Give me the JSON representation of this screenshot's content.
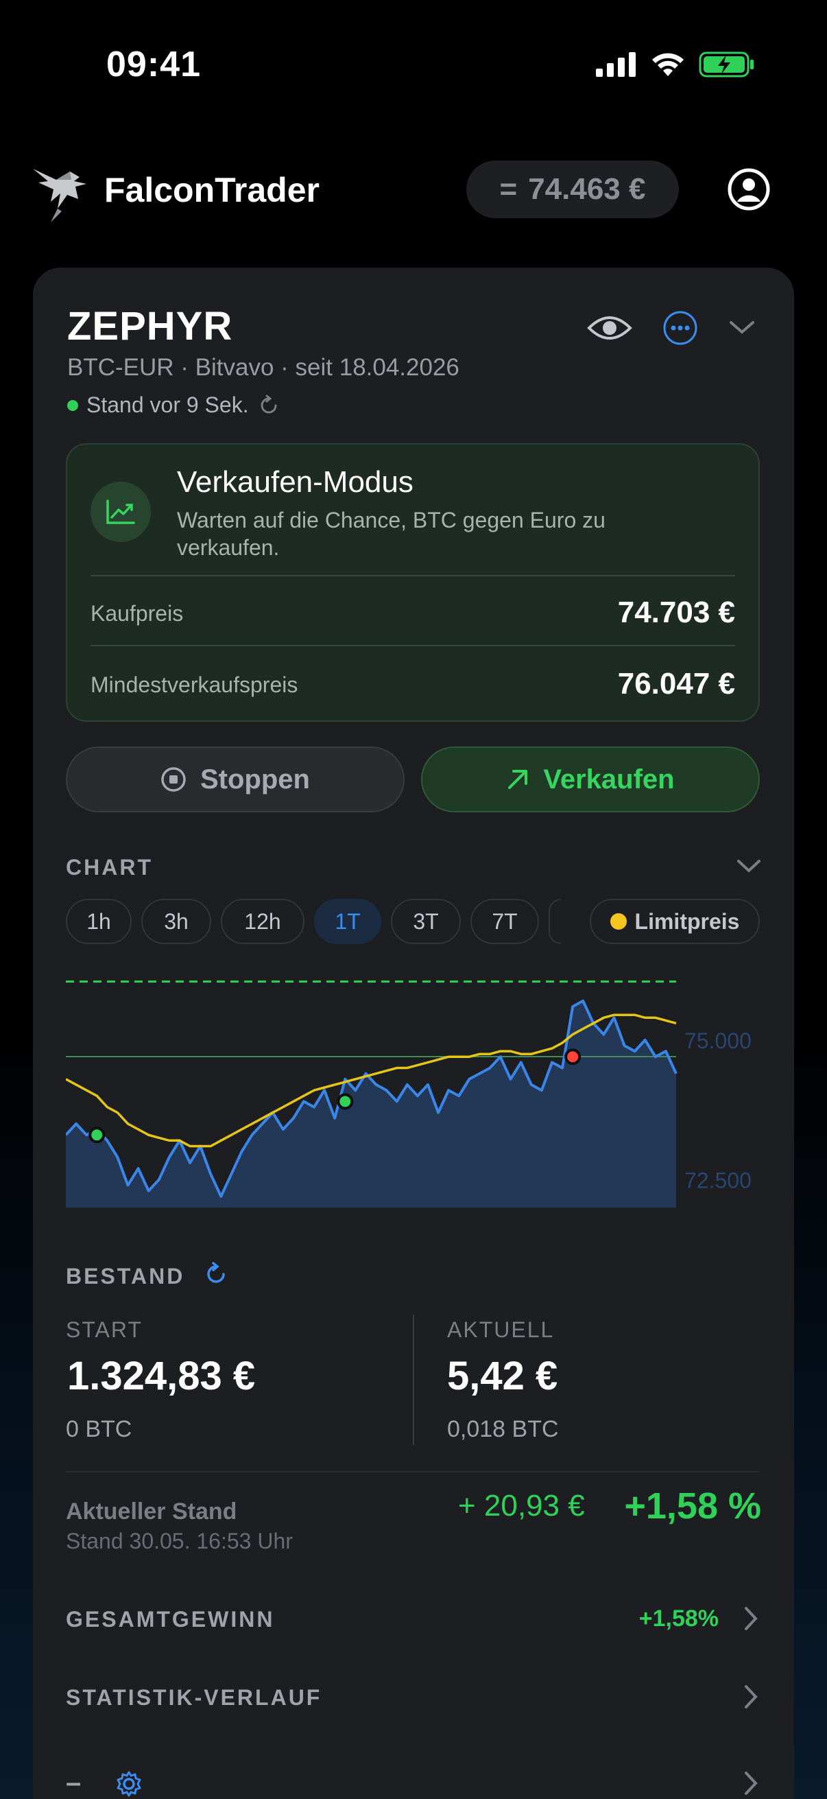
{
  "status_bar": {
    "time": "09:41"
  },
  "header": {
    "app_name": "FalconTrader",
    "balance_prefix": "=",
    "balance": "74.463 €"
  },
  "strategy": {
    "name": "ZEPHYR",
    "meta": "BTC-EUR · Bitvavo · seit 18.04.2026",
    "status": "Stand vor 9 Sek."
  },
  "mode": {
    "title": "Verkaufen-Modus",
    "description": "Warten auf die Chance, BTC gegen Euro zu verkaufen.",
    "rows": [
      {
        "label": "Kaufpreis",
        "value": "74.703 €"
      },
      {
        "label": "Mindestverkaufspreis",
        "value": "76.047 €"
      }
    ]
  },
  "actions": {
    "stop_label": "Stoppen",
    "sell_label": "Verkaufen"
  },
  "chart_section": {
    "label": "CHART",
    "ranges": [
      "1h",
      "3h",
      "12h",
      "1T",
      "3T",
      "7T"
    ],
    "active_range": "1T",
    "limit_label": "Limitpreis"
  },
  "chart_data": {
    "type": "area",
    "y_tick_labels": [
      "75.000",
      "72.500"
    ],
    "ylim": [
      72000,
      76300
    ],
    "limit_price": 76047,
    "buy_price": 74703,
    "series": [
      {
        "values": [
          73300,
          73500,
          73300,
          73400,
          73200,
          72900,
          72400,
          72700,
          72300,
          72500,
          72900,
          73200,
          72800,
          73100,
          72600,
          72200,
          72600,
          73000,
          73300,
          73500,
          73700,
          73400,
          73600,
          73900,
          73800,
          74100,
          73600,
          74300,
          74100,
          74400,
          74200,
          74100,
          73900,
          74200,
          74000,
          74200,
          73700,
          74100,
          74000,
          74300,
          74400,
          74500,
          74700,
          74300,
          74600,
          74200,
          74100,
          74600,
          74500,
          75600,
          75700,
          75300,
          75100,
          75400,
          74900,
          74800,
          75000,
          74700,
          74800,
          74400
        ]
      },
      {
        "values": [
          74300,
          74200,
          74100,
          74000,
          73800,
          73700,
          73500,
          73400,
          73300,
          73250,
          73200,
          73200,
          73100,
          73100,
          73100,
          73200,
          73300,
          73400,
          73500,
          73600,
          73700,
          73800,
          73900,
          74000,
          74100,
          74150,
          74200,
          74250,
          74300,
          74350,
          74400,
          74450,
          74500,
          74500,
          74550,
          74600,
          74650,
          74700,
          74700,
          74700,
          74750,
          74750,
          74800,
          74800,
          74750,
          74750,
          74800,
          74850,
          74950,
          75100,
          75200,
          75300,
          75400,
          75450,
          75450,
          75450,
          75400,
          75400,
          75350,
          75300
        ]
      }
    ],
    "markers": [
      {
        "index": 3,
        "value": 73300,
        "kind": "buy"
      },
      {
        "index": 27,
        "value": 73900,
        "kind": "buy"
      },
      {
        "index": 49,
        "value": 74700,
        "kind": "sell"
      }
    ],
    "colors": {
      "price": "#3a86e8",
      "average": "#e6c51b",
      "limit": "#2fd158",
      "buy": "#2fd158",
      "sell": "#ff453a"
    }
  },
  "holdings": {
    "label": "BESTAND",
    "start": {
      "label": "START",
      "value": "1.324,83 €",
      "sub": "0 BTC"
    },
    "current": {
      "label": "AKTUELL",
      "value": "5,42 €",
      "sub": "0,018 BTC"
    }
  },
  "current_state": {
    "label": "Aktueller Stand",
    "sub": "Stand 30.05. 16:53 Uhr",
    "abs": "+ 20,93 €",
    "pct": "+1,58 %"
  },
  "list": {
    "total_profit_label": "GESAMTGEWINN",
    "total_profit_value": "+1,58%",
    "stats_label": "STATISTIK-VERLAUF",
    "last_prefix": "–"
  }
}
